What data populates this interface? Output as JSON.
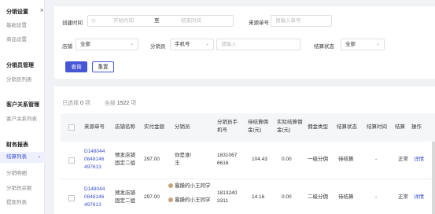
{
  "sidebar": {
    "collapse_icon": "»",
    "groups": [
      {
        "title": "分销设置",
        "items": [
          "基础设置",
          "商品设置"
        ]
      },
      {
        "title": "分销员管理",
        "items": [
          "分销员列表"
        ]
      },
      {
        "title": "客户关系管理",
        "items": [
          "客户关系列表"
        ]
      },
      {
        "title": "财务报表",
        "items": [
          "结算列表",
          "分销明细",
          "分销员余额",
          "提现列表"
        ]
      }
    ]
  },
  "filter": {
    "create_time_label": "创建时间",
    "start_placeholder": "开始时间",
    "range_sep": "至",
    "end_placeholder": "结束时间",
    "source_no_label": "来源单号",
    "source_no_placeholder": "请输入单号",
    "store_label": "店铺",
    "store_value": "全部",
    "distributor_label": "分销员",
    "distributor_type_value": "手机号",
    "distributor_placeholder": "请输入",
    "settle_status_label": "结算状态",
    "settle_status_value": "全部",
    "query_label": "查询",
    "reset_label": "重置"
  },
  "selection": {
    "selected_prefix": "已选择",
    "selected_count": "0",
    "selected_suffix": "项",
    "total_prefix": "全部",
    "total_count": "1522",
    "total_suffix": "项"
  },
  "table": {
    "headers": [
      "来源单号",
      "店铺名称",
      "实付金额",
      "分销员",
      "分销员手机号",
      "待结算佣金(元)",
      "实际结算佣金(元)",
      "佣金类型",
      "结算状态",
      "结算时间",
      "结算",
      "操作"
    ],
    "rows": [
      {
        "order_no": "D148044 0848146 497613",
        "store": "预发店铺 固定二组",
        "paid": "297.00",
        "distributors": [
          "你是谁!",
          "王"
        ],
        "phone": "1831067 6616",
        "pending": "104.43",
        "actual": "0.00",
        "type": "一级分佣",
        "status": "待结算",
        "time": "-",
        "settle": "正常",
        "action": "详情"
      },
      {
        "order_no": "D148044 0848146 497613",
        "store": "预发店铺 固定二组",
        "paid": "297.00",
        "distributors": [
          "暴躁的小王同学",
          "暴躁的小王同学"
        ],
        "phone": "1813240 3311",
        "pending": "14.16",
        "actual": "0.00",
        "type": "二级分佣",
        "status": "待结算",
        "time": "-",
        "settle": "正常",
        "action": "详情"
      }
    ]
  }
}
